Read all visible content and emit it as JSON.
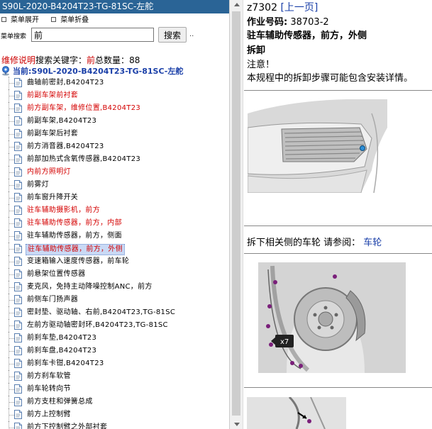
{
  "title_bar": "S90L-2020-B4204T23-TG-81SC-左舵",
  "toolbar": {
    "expand_all": "菜单展开",
    "collapse_all": "菜单折叠"
  },
  "search": {
    "label": "菜单搜索",
    "value": "前",
    "button": "搜索",
    "extra": ".."
  },
  "search_info": {
    "prefix": "维修说明",
    "keyword_label": "搜索关键字：",
    "keyword": "前",
    "count_label": "总数量：",
    "count": "88"
  },
  "current": "当前:S90L-2020-B4204T23-TG-81SC-左舵",
  "tree": [
    {
      "text": "曲轴前密封,B4204T23",
      "style": "normal"
    },
    {
      "text": "前副车架前衬套",
      "style": "red"
    },
    {
      "text": "前方副车架，维修位置,B4204T23",
      "style": "red"
    },
    {
      "text": "前副车架,B4204T23",
      "style": "normal"
    },
    {
      "text": "前副车架后衬套",
      "style": "normal"
    },
    {
      "text": "前方消音器,B4204T23",
      "style": "normal"
    },
    {
      "text": "前部加热式含氧传感器,B4204T23",
      "style": "normal"
    },
    {
      "text": "内前方照明灯",
      "style": "red"
    },
    {
      "text": "前雾灯",
      "style": "normal"
    },
    {
      "text": "前车窗升降开关",
      "style": "normal"
    },
    {
      "text": "驻车辅助摄影机，前方",
      "style": "red"
    },
    {
      "text": "驻车辅助传感器，前方，内部",
      "style": "red"
    },
    {
      "text": "驻车辅助传感器，前方，侧面",
      "style": "normal"
    },
    {
      "text": "驻车辅助传感器，前方，外侧",
      "style": "selected"
    },
    {
      "text": "变速箱输入速度传感器，前车轮",
      "style": "normal"
    },
    {
      "text": "前悬架位置传感器",
      "style": "normal"
    },
    {
      "text": "麦克风，免持主动降噪控制ANC，前方",
      "style": "normal"
    },
    {
      "text": "前侧车门扬声器",
      "style": "normal"
    },
    {
      "text": "密封垫、驱动轴、右前,B4204T23,TG-81SC",
      "style": "normal"
    },
    {
      "text": "左前方驱动轴密封环,B4204T23,TG-81SC",
      "style": "normal"
    },
    {
      "text": "前刹车垫,B4204T23",
      "style": "normal"
    },
    {
      "text": "前刹车盘,B4204T23",
      "style": "normal"
    },
    {
      "text": "前刹车卡钳,B4204T23",
      "style": "normal"
    },
    {
      "text": "前方刹车软管",
      "style": "normal"
    },
    {
      "text": "前车轮转向节",
      "style": "normal"
    },
    {
      "text": "前方支柱和弹簧总成",
      "style": "normal"
    },
    {
      "text": "前方上控制臂",
      "style": "normal"
    },
    {
      "text": "前方下控制臂之外部衬套",
      "style": "normal"
    }
  ],
  "doc": {
    "code": "z7302",
    "prev_link": "[上一页]",
    "part_label": "作业号码:",
    "part_number": "38703-2",
    "part_name": "驻车辅助传感器，前方，外侧",
    "section": "拆卸",
    "note_title": "注意！",
    "note_text": "本规程中的拆卸步骤可能包含安装详情。",
    "step_text": "拆下相关侧的车轮 请参阅：",
    "step_link": "车轮",
    "badge": "x7"
  },
  "colors": {
    "title_bar": "#2a6496",
    "link": "#1a3fa8",
    "red_item": "#d40000",
    "selected_bg": "#c9d9f5"
  }
}
